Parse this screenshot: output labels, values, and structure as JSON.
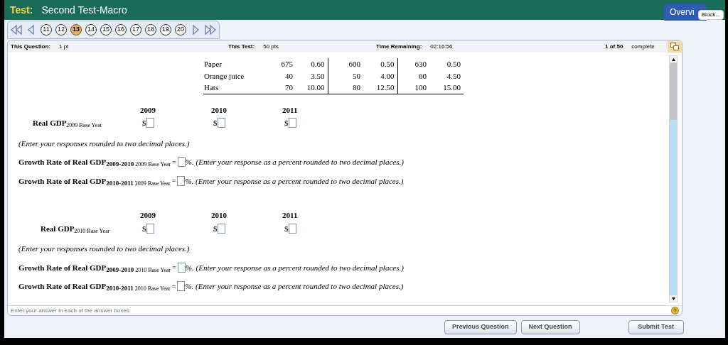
{
  "header": {
    "label": "Test:",
    "title": "Second Test-Macro",
    "overview_button": "Overvi",
    "tooltip": "Block..."
  },
  "question_nav": [
    {
      "label": "11",
      "selected": false
    },
    {
      "label": "12",
      "selected": false
    },
    {
      "label": "13",
      "selected": true
    },
    {
      "label": "14",
      "selected": false
    },
    {
      "label": "15",
      "selected": false
    },
    {
      "label": "16",
      "selected": false
    },
    {
      "label": "17",
      "selected": false
    },
    {
      "label": "18",
      "selected": false
    },
    {
      "label": "19",
      "selected": false
    },
    {
      "label": "20",
      "selected": false
    }
  ],
  "info_bar": {
    "question_label": "This Question:",
    "question_value": "1 pt",
    "test_label": "This Test:",
    "test_value": "50 pts",
    "time_label": "Time Remaining:",
    "time_value": "02:16:56",
    "progress": "1 of 50",
    "progress_label": "complete"
  },
  "table": {
    "rows": [
      {
        "item": "Paper",
        "values": [
          "675",
          "0.60",
          "600",
          "0.50",
          "630",
          "0.50"
        ]
      },
      {
        "item": "Orange juice",
        "values": [
          "40",
          "3.50",
          "50",
          "4.00",
          "60",
          "4.50"
        ]
      },
      {
        "item": "Hats",
        "values": [
          "70",
          "10.00",
          "80",
          "12.50",
          "100",
          "15.00"
        ]
      }
    ]
  },
  "sections": [
    {
      "years": [
        "2009",
        "2010",
        "2011"
      ],
      "label": "Real GDP",
      "label_sub": "2009 Base Year",
      "currency": [
        "$",
        "$",
        "$"
      ],
      "note": "(Enter your responses rounded to two decimal places.)",
      "growth": [
        {
          "label": "Growth Rate of Real GDP",
          "period": "2009-2010",
          "base": "2009 Base Year",
          "equals": "=",
          "tail": "%. (Enter your response as a percent rounded to two decimal places.)"
        },
        {
          "label": "Growth Rate of Real GDP",
          "period": "2010-2011",
          "base": "2009 Base Year",
          "equals": "=",
          "tail": "%. (Enter your response as a percent rounded to two decimal places.)"
        }
      ]
    },
    {
      "years": [
        "2009",
        "2010",
        "2011"
      ],
      "label": "Real GDP",
      "label_sub": "2010 Base Year",
      "currency": [
        "$",
        "$",
        "$"
      ],
      "note": "(Enter your responses rounded to two decimal places.)",
      "growth": [
        {
          "label": "Growth Rate of Real GDP",
          "period": "2009-2010",
          "base": "2010 Base Year",
          "equals": "=",
          "tail": "%. (Enter your response as a percent rounded to two decimal places.)"
        },
        {
          "label": "Growth Rate of Real GDP",
          "period": "2010-2011",
          "base": "2010 Base Year",
          "equals": "=",
          "tail": "%. (Enter your response as a percent rounded to two decimal places.)"
        }
      ]
    }
  ],
  "help_icon": "?",
  "footer_hint": "Enter your answer in each of the answer boxes.",
  "buttons": [
    "Previous Question",
    "Next Question",
    "Submit Test"
  ]
}
